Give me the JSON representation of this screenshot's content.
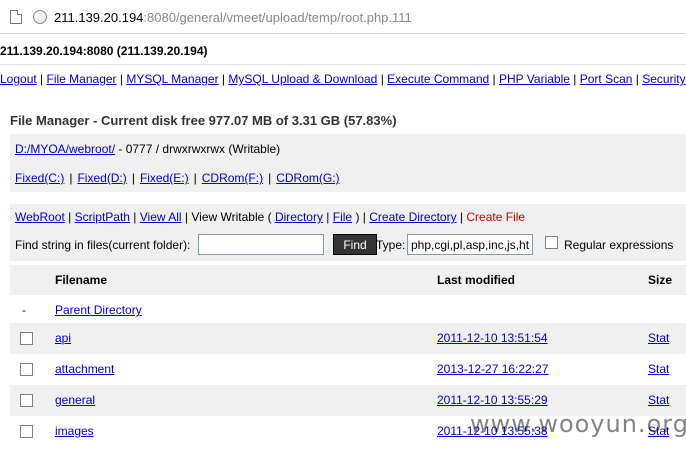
{
  "browser": {
    "url_host": "211.139.20.194",
    "url_rest": ":8080/general/vmeet/upload/temp/root.php.111"
  },
  "host_line": "211.139.20.194:8080 (211.139.20.194)",
  "nav": [
    {
      "label": "Logout"
    },
    {
      "label": "File Manager"
    },
    {
      "label": "MYSQL Manager"
    },
    {
      "label": "MySQL Upload & Download"
    },
    {
      "label": "Execute Command"
    },
    {
      "label": "PHP Variable"
    },
    {
      "label": "Port Scan"
    },
    {
      "label": "Security"
    }
  ],
  "title": "File Manager - Current disk free 977.07 MB of 3.31 GB (57.83%)",
  "path": {
    "link": "D:/MYOA/webroot/",
    "info": " - 0777 / drwxrwxrwx (Writable)"
  },
  "drives": [
    "Fixed(C:)",
    "Fixed(D:)",
    "Fixed(E:)",
    "CDRom(F:)",
    "CDRom(G:)"
  ],
  "actions": {
    "webroot": "WebRoot",
    "scriptpath": "ScriptPath",
    "view_all": "View All",
    "view_writable": " | View Writable ( ",
    "directory": "Directory",
    "file": "File",
    "create_directory": "Create Directory",
    "create_file": "Create File"
  },
  "find": {
    "label": "Find string in files(current folder):",
    "value": "",
    "button": "Find",
    "type_label": "Type:",
    "type_value": "php,cgi,pl,asp,inc,js,html",
    "regex_label": "Regular expressions"
  },
  "table": {
    "headers": {
      "filename": "Filename",
      "modified": "Last modified",
      "size": "Size"
    },
    "parent": {
      "dash": "-",
      "label": "Parent Directory"
    },
    "rows": [
      {
        "name": "api",
        "modified": "2011-12-10 13:51:54",
        "size": "Stat"
      },
      {
        "name": "attachment",
        "modified": "2013-12-27 16:22:27",
        "size": "Stat"
      },
      {
        "name": "general",
        "modified": "2011-12-10 13:55:29",
        "size": "Stat"
      },
      {
        "name": "images",
        "modified": "2011-12-10 13:55:38",
        "size": "Stat"
      }
    ]
  },
  "watermark": "www.wooyun.org"
}
